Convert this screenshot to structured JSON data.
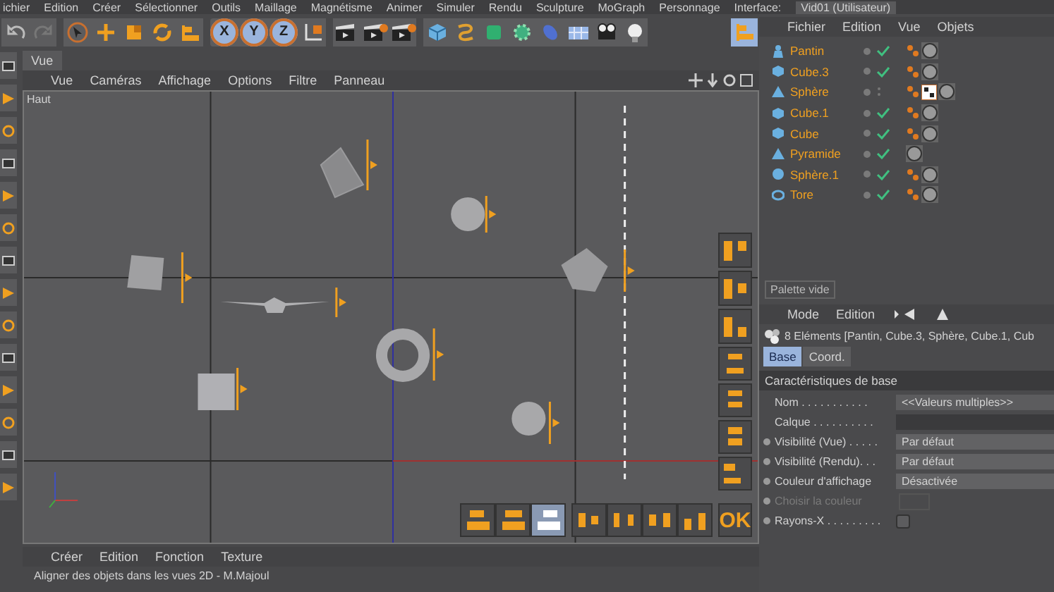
{
  "menubar": {
    "items": [
      "ichier",
      "Edition",
      "Créer",
      "Sélectionner",
      "Outils",
      "Maillage",
      "Magnétisme",
      "Animer",
      "Simuler",
      "Rendu",
      "Sculpture",
      "MoGraph",
      "Personnage"
    ],
    "interface_label": "Interface:",
    "interface_value": "Vid01 (Utilisateur)"
  },
  "toolbar": {
    "axes": [
      {
        "label": "X",
        "selected": true
      },
      {
        "label": "Y",
        "selected": true
      },
      {
        "label": "Z",
        "selected": true
      }
    ]
  },
  "viewport": {
    "tab": "Vue",
    "menu": [
      "Vue",
      "Caméras",
      "Affichage",
      "Options",
      "Filtre",
      "Panneau"
    ],
    "label": "Haut",
    "align_side": [
      {
        "selected": false
      },
      {
        "selected": false
      },
      {
        "selected": false
      },
      {
        "selected": false
      },
      {
        "selected": false
      },
      {
        "selected": false
      },
      {
        "selected": false
      }
    ],
    "align_bottom": [
      {
        "selected": false
      },
      {
        "selected": false
      },
      {
        "selected": true
      },
      {
        "selected": false
      },
      {
        "selected": false
      },
      {
        "selected": false
      },
      {
        "selected": false
      }
    ],
    "ok": "OK"
  },
  "bottom_menu": [
    "Créer",
    "Edition",
    "Fonction",
    "Texture"
  ],
  "status_bar": "Aligner des objets dans les vues 2D - M.Majoul",
  "objects": {
    "menu": [
      "Fichier",
      "Edition",
      "Vue",
      "Objets"
    ],
    "rows": [
      {
        "name": "Pantin",
        "kind": "figure",
        "enabled": true,
        "tags": [
          {
            "kind": "dots"
          },
          {
            "kind": "material"
          }
        ]
      },
      {
        "name": "Cube.3",
        "kind": "cube",
        "enabled": true,
        "tags": [
          {
            "kind": "dots"
          },
          {
            "kind": "material"
          }
        ]
      },
      {
        "name": "Sphère",
        "kind": "pyramid",
        "enabled": false,
        "tags": [
          {
            "kind": "dots"
          },
          {
            "kind": "texture"
          },
          {
            "kind": "material"
          }
        ]
      },
      {
        "name": "Cube.1",
        "kind": "cube",
        "enabled": true,
        "tags": [
          {
            "kind": "dots"
          },
          {
            "kind": "material"
          }
        ]
      },
      {
        "name": "Cube",
        "kind": "cube",
        "enabled": true,
        "tags": [
          {
            "kind": "dots"
          },
          {
            "kind": "material"
          }
        ]
      },
      {
        "name": "Pyramide",
        "kind": "pyramid",
        "enabled": true,
        "tags": [
          {
            "kind": "material"
          }
        ]
      },
      {
        "name": "Sphère.1",
        "kind": "sphere",
        "enabled": true,
        "tags": [
          {
            "kind": "dots"
          },
          {
            "kind": "material"
          }
        ]
      },
      {
        "name": "Tore",
        "kind": "torus",
        "enabled": true,
        "tags": [
          {
            "kind": "dots"
          },
          {
            "kind": "material"
          }
        ]
      }
    ]
  },
  "palette": "Palette vide",
  "attributes": {
    "menu": [
      "Mode",
      "Edition"
    ],
    "summary": "8 Eléments [Pantin, Cube.3, Sphère, Cube.1, Cub",
    "tabs": [
      {
        "label": "Base",
        "selected": true
      },
      {
        "label": "Coord.",
        "selected": false
      }
    ],
    "section": "Caractéristiques de base",
    "rows": [
      {
        "label": "Nom . . . . . . . . . . .",
        "kind": "text",
        "value": "<<Valeurs multiples>>",
        "dot": false,
        "disabled": false
      },
      {
        "label": "Calque . . . . . . . . . .",
        "kind": "layer",
        "dot": false,
        "disabled": false
      },
      {
        "label": "Visibilité (Vue) . . . . .",
        "kind": "dropdown",
        "value": "Par défaut",
        "dot": true,
        "disabled": false
      },
      {
        "label": "Visibilité (Rendu). . .",
        "kind": "dropdown",
        "value": "Par défaut",
        "dot": true,
        "disabled": false
      },
      {
        "label": "Couleur d'affichage",
        "kind": "dropdown",
        "value": "Désactivée",
        "dot": true,
        "disabled": false
      },
      {
        "label": "Choisir la couleur",
        "kind": "color",
        "dot": true,
        "disabled": true
      },
      {
        "label": "Rayons-X . . . . . . . . .",
        "kind": "checkbox",
        "checked": false,
        "dot": true,
        "disabled": false
      }
    ]
  }
}
